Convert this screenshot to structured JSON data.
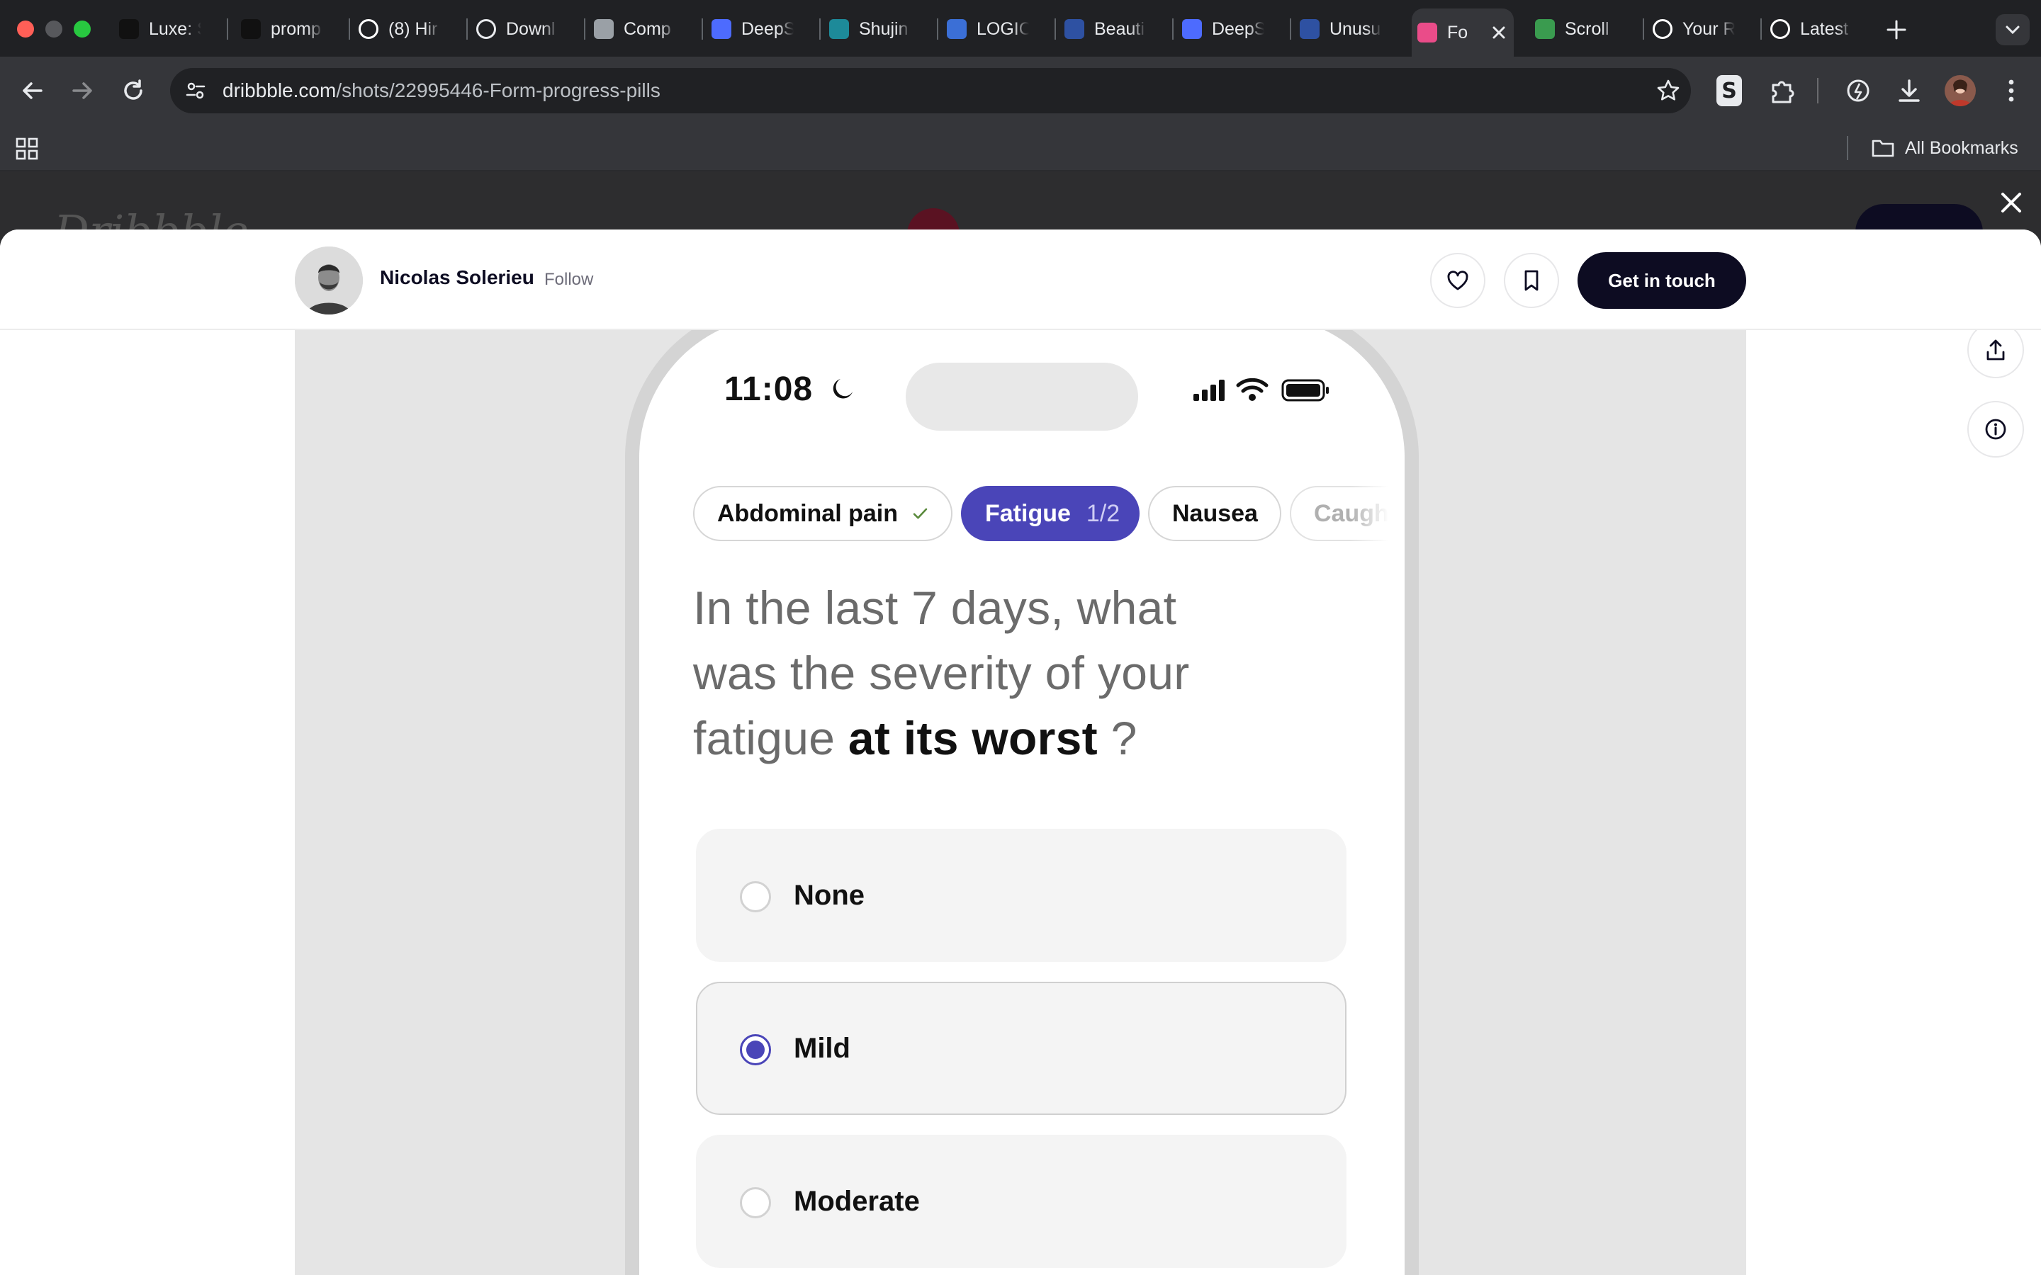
{
  "browser": {
    "tabs": [
      {
        "title": "Luxe: S",
        "icon": "luxe-logo-icon",
        "color": "#111111"
      },
      {
        "title": "promp",
        "icon": "chat-bubble-icon",
        "color": "#111111"
      },
      {
        "title": "(8) Hir",
        "icon": "notion-icon",
        "color": "#ffffff"
      },
      {
        "title": "Downl",
        "icon": "download-icon",
        "color": "#e8eaed"
      },
      {
        "title": "Comp",
        "icon": "globe-icon",
        "color": "#9aa0a6"
      },
      {
        "title": "DeepS",
        "icon": "deepseek-whale-icon",
        "color": "#4d6bfe"
      },
      {
        "title": "Shujin",
        "icon": "shujin-b-icon",
        "color": "#1d8a99"
      },
      {
        "title": "LOGIC",
        "icon": "logic-circle-icon",
        "color": "#3b6fd6"
      },
      {
        "title": "Beauti",
        "icon": "mal-icon",
        "color": "#2e51a2"
      },
      {
        "title": "DeepS",
        "icon": "deepseek-whale-icon",
        "color": "#4d6bfe"
      },
      {
        "title": "Unusu",
        "icon": "mal-icon",
        "color": "#2e51a2"
      },
      {
        "title": "Fo",
        "icon": "dribbble-icon",
        "color": "#ea4c89",
        "active": true
      },
      {
        "title": "Scroll",
        "icon": "producthunt-p-icon",
        "color": "#3a9b4f"
      },
      {
        "title": "Your R",
        "icon": "github-icon",
        "color": "#ffffff"
      },
      {
        "title": "Latest",
        "icon": "openai-icon",
        "color": "#ffffff"
      }
    ],
    "url_domain": "dribbble.com",
    "url_path": "/shots/22995446-Form-progress-pills",
    "bookmarks_label": "All Bookmarks"
  },
  "background_page": {
    "logo_text": "Dribbble"
  },
  "shot_header": {
    "designer_name": "Nicolas Solerieu",
    "follow_label": "Follow",
    "cta_label": "Get in touch"
  },
  "phone": {
    "status_time": "11:08",
    "pills": [
      {
        "label": "Abdominal pain",
        "state": "done"
      },
      {
        "label": "Fatigue",
        "count": "1/2",
        "state": "active"
      },
      {
        "label": "Nausea",
        "state": "pending"
      },
      {
        "label": "Caugh",
        "state": "faded"
      }
    ],
    "question_lead": "In the last 7 days, what was the severity of your fatigue",
    "question_emphasis": "at its worst",
    "question_tail": "?",
    "options": [
      {
        "label": "None",
        "selected": false
      },
      {
        "label": "Mild",
        "selected": true
      },
      {
        "label": "Moderate",
        "selected": false
      }
    ]
  },
  "colors": {
    "accent": "#4a45b8",
    "dribbble_pink": "#ea4c89",
    "cta_dark": "#0d0c22"
  }
}
